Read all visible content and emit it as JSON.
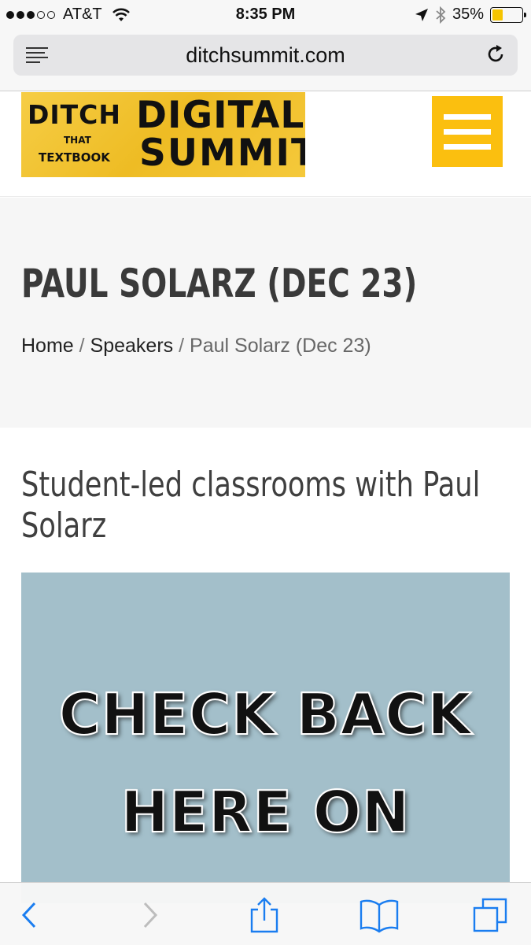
{
  "status_bar": {
    "carrier": "AT&T",
    "time": "8:35 PM",
    "battery_percent": "35%",
    "battery_level": 0.35,
    "battery_color": "#f5c400",
    "signal_bars_filled": 3,
    "signal_bars_total": 5
  },
  "browser": {
    "url": "ditchsummit.com",
    "reader_icon": "reader-view-icon",
    "reload_icon": "reload-icon"
  },
  "header": {
    "logo": {
      "line_ditch": "DITCH",
      "line_that": "THAT",
      "line_textbook": "TEXTBOOK",
      "line_digital": "DIGITAL",
      "line_summit": "SUMMIT"
    },
    "menu_icon": "hamburger-menu-icon",
    "accent_color": "#fbbf0f"
  },
  "title_band": {
    "title": "PAUL SOLARZ (DEC 23)",
    "breadcrumb": {
      "home": "Home",
      "separator": "/",
      "speakers": "Speakers",
      "current": "Paul Solarz (Dec 23)"
    }
  },
  "content": {
    "heading": "Student-led classrooms with Paul Solarz",
    "image": {
      "line1": "CHECK BACK",
      "line2": "HERE ON",
      "background": "#a3bfca"
    }
  },
  "toolbar": {
    "back_icon": "back-arrow-icon",
    "forward_icon": "forward-arrow-icon",
    "share_icon": "share-icon",
    "bookmarks_icon": "bookmarks-icon",
    "tabs_icon": "tabs-icon"
  }
}
